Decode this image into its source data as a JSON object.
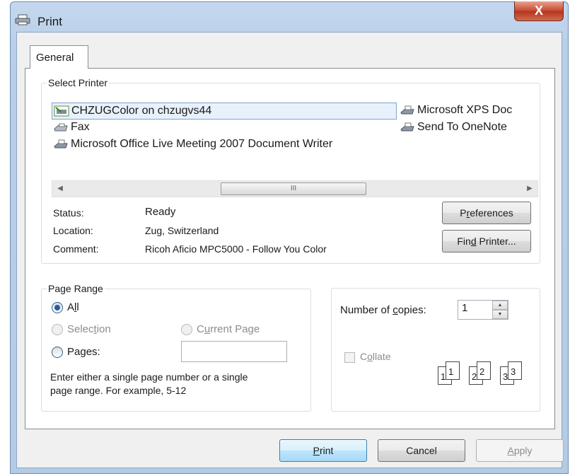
{
  "window": {
    "title": "Print",
    "close_symbol": "X"
  },
  "tabs": [
    {
      "label": "General"
    }
  ],
  "select_printer": {
    "legend": "Select Printer",
    "printers": [
      {
        "name": "CHZUGColor on chzugvs44",
        "selected": true,
        "icon": "printer-network-icon"
      },
      {
        "name": "Fax",
        "selected": false,
        "icon": "fax-icon"
      },
      {
        "name": "Microsoft Office Live Meeting 2007 Document Writer",
        "selected": false,
        "icon": "printer-icon"
      },
      {
        "name": "Microsoft XPS Doc",
        "selected": false,
        "icon": "printer-icon"
      },
      {
        "name": "Send To OneNote",
        "selected": false,
        "icon": "printer-icon"
      }
    ],
    "scroll_thumb_grip": "III",
    "status_label": "Status:",
    "status_value": "Ready",
    "location_label": "Location:",
    "location_value": "Zug, Switzerland",
    "comment_label": "Comment:",
    "comment_value": "Ricoh Aficio MPC5000 - Follow You Color",
    "preferences_button": {
      "before": "P",
      "accel": "r",
      "after": "eferences"
    },
    "find_printer_button": {
      "before": "Fin",
      "accel": "d",
      "after": " Printer..."
    }
  },
  "page_range": {
    "legend": "Page Range",
    "all": {
      "label": "All",
      "before": "A",
      "accel": "l",
      "after": "l",
      "checked": true
    },
    "selection": {
      "before": "Selec",
      "accel": "t",
      "after": "ion",
      "disabled": true
    },
    "current_page": {
      "before": "C",
      "accel": "u",
      "after": "rrent Page",
      "disabled": true
    },
    "pages": {
      "before": "Pa",
      "accel": "g",
      "after": "es:",
      "value": ""
    },
    "hint_line1": "Enter either a single page number or a single",
    "hint_line2": "page range.  For example, 5-12"
  },
  "copies": {
    "label_before": "Number of ",
    "label_accel": "c",
    "label_after": "opies:",
    "value": "1",
    "collate": {
      "before": "C",
      "accel": "o",
      "after": "llate",
      "checked": false,
      "disabled": true
    },
    "collate_pages": [
      "1",
      "1",
      "2",
      "2",
      "3",
      "3"
    ]
  },
  "buttons": {
    "print": {
      "accel": "P",
      "after": "rint"
    },
    "cancel": {
      "label": "Cancel"
    },
    "apply": {
      "accel": "A",
      "after": "pply",
      "disabled": true
    }
  },
  "colors": {
    "accent": "#3c7fb1",
    "selection_bg": "#e8f1fb",
    "close_red": "#c84b33",
    "frame": "#b9cfe9"
  }
}
